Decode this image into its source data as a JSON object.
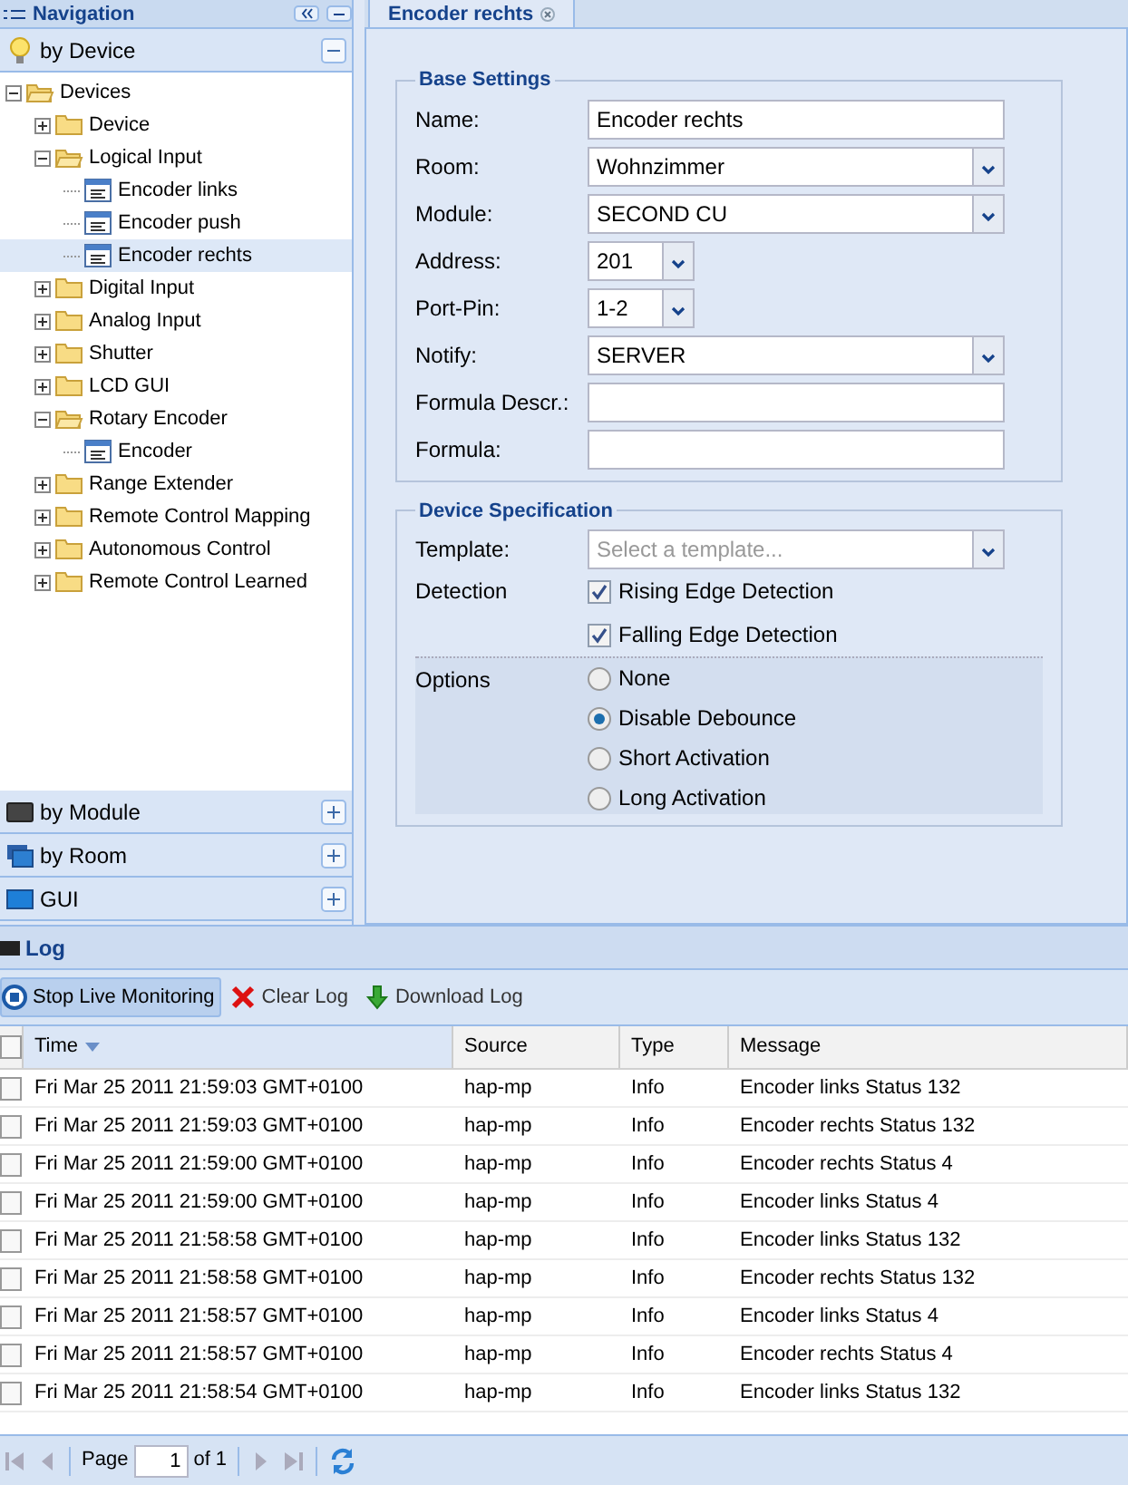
{
  "navigation": {
    "title": "Navigation",
    "panels": [
      {
        "label": "by Device",
        "expanded": true
      },
      {
        "label": "by Module",
        "expanded": false
      },
      {
        "label": "by Room",
        "expanded": false
      },
      {
        "label": "GUI",
        "expanded": false
      }
    ],
    "tree": [
      {
        "label": "Devices",
        "kind": "folder",
        "expanded": true,
        "selected": false,
        "children": [
          {
            "label": "Device",
            "kind": "folder",
            "expanded": false,
            "selected": false
          },
          {
            "label": "Logical Input",
            "kind": "folder",
            "expanded": true,
            "selected": false,
            "children": [
              {
                "label": "Encoder links",
                "kind": "leaf",
                "selected": false
              },
              {
                "label": "Encoder push",
                "kind": "leaf",
                "selected": false
              },
              {
                "label": "Encoder rechts",
                "kind": "leaf",
                "selected": true
              }
            ]
          },
          {
            "label": "Digital Input",
            "kind": "folder",
            "expanded": false,
            "selected": false
          },
          {
            "label": "Analog Input",
            "kind": "folder",
            "expanded": false,
            "selected": false
          },
          {
            "label": "Shutter",
            "kind": "folder",
            "expanded": false,
            "selected": false
          },
          {
            "label": "LCD GUI",
            "kind": "folder",
            "expanded": false,
            "selected": false
          },
          {
            "label": "Rotary Encoder",
            "kind": "folder",
            "expanded": true,
            "selected": false,
            "children": [
              {
                "label": "Encoder",
                "kind": "leaf",
                "selected": false
              }
            ]
          },
          {
            "label": "Range Extender",
            "kind": "folder",
            "expanded": false,
            "selected": false
          },
          {
            "label": "Remote Control Mapping",
            "kind": "folder",
            "expanded": false,
            "selected": false
          },
          {
            "label": "Autonomous Control",
            "kind": "folder",
            "expanded": false,
            "selected": false
          },
          {
            "label": "Remote Control Learned",
            "kind": "folder",
            "expanded": false,
            "selected": false
          }
        ]
      }
    ]
  },
  "tab": {
    "label": "Encoder rechts"
  },
  "base_settings": {
    "title": "Base Settings",
    "fields": [
      {
        "label": "Name:",
        "kind": "text",
        "value": "Encoder rechts"
      },
      {
        "label": "Room:",
        "kind": "combo",
        "value": "Wohnzimmer"
      },
      {
        "label": "Module:",
        "kind": "combo",
        "value": "SECOND CU"
      },
      {
        "label": "Address:",
        "kind": "short_combo",
        "value": "201"
      },
      {
        "label": "Port-Pin:",
        "kind": "short_combo",
        "value": "1-2"
      },
      {
        "label": "Notify:",
        "kind": "combo",
        "value": "SERVER"
      },
      {
        "label": "Formula Descr.:",
        "kind": "text"
      },
      {
        "label": "Formula:",
        "kind": "text"
      }
    ]
  },
  "device_specification": {
    "title": "Device Specification",
    "template": {
      "label": "Template:",
      "placeholder": "Select a template..."
    },
    "detection": {
      "label": "Detection",
      "checkboxes": [
        {
          "label": "Rising Edge Detection",
          "checked": true
        },
        {
          "label": "Falling Edge Detection",
          "checked": true
        }
      ]
    },
    "options": {
      "label": "Options",
      "radios": [
        {
          "label": "None",
          "selected": false
        },
        {
          "label": "Disable Debounce",
          "selected": true
        },
        {
          "label": "Short Activation",
          "selected": false
        },
        {
          "label": "Long Activation",
          "selected": false
        }
      ]
    }
  },
  "log": {
    "title": "Log",
    "toolbar": [
      {
        "label": "Stop Live Monitoring",
        "kind": "stop",
        "pressed": true
      },
      {
        "label": "Clear Log",
        "kind": "clear",
        "pressed": false
      },
      {
        "label": "Download Log",
        "kind": "download",
        "pressed": false
      }
    ],
    "columns": [
      {
        "label": "Time",
        "sorted": true
      },
      {
        "label": "Source",
        "sorted": false
      },
      {
        "label": "Type",
        "sorted": false
      },
      {
        "label": "Message",
        "sorted": false
      }
    ],
    "rows": [
      [
        "Fri Mar 25 2011 21:59:03 GMT+0100",
        "hap-mp",
        "Info",
        "Encoder links Status 132"
      ],
      [
        "Fri Mar 25 2011 21:59:03 GMT+0100",
        "hap-mp",
        "Info",
        "Encoder rechts Status 132"
      ],
      [
        "Fri Mar 25 2011 21:59:00 GMT+0100",
        "hap-mp",
        "Info",
        "Encoder rechts Status 4"
      ],
      [
        "Fri Mar 25 2011 21:59:00 GMT+0100",
        "hap-mp",
        "Info",
        "Encoder links Status 4"
      ],
      [
        "Fri Mar 25 2011 21:58:58 GMT+0100",
        "hap-mp",
        "Info",
        "Encoder links Status 132"
      ],
      [
        "Fri Mar 25 2011 21:58:58 GMT+0100",
        "hap-mp",
        "Info",
        "Encoder rechts Status 132"
      ],
      [
        "Fri Mar 25 2011 21:58:57 GMT+0100",
        "hap-mp",
        "Info",
        "Encoder links Status 4"
      ],
      [
        "Fri Mar 25 2011 21:58:57 GMT+0100",
        "hap-mp",
        "Info",
        "Encoder rechts Status 4"
      ],
      [
        "Fri Mar 25 2011 21:58:54 GMT+0100",
        "hap-mp",
        "Info",
        "Encoder links Status 132"
      ]
    ],
    "paging": {
      "page_label": "Page",
      "page": "1",
      "of": "of 1"
    }
  }
}
